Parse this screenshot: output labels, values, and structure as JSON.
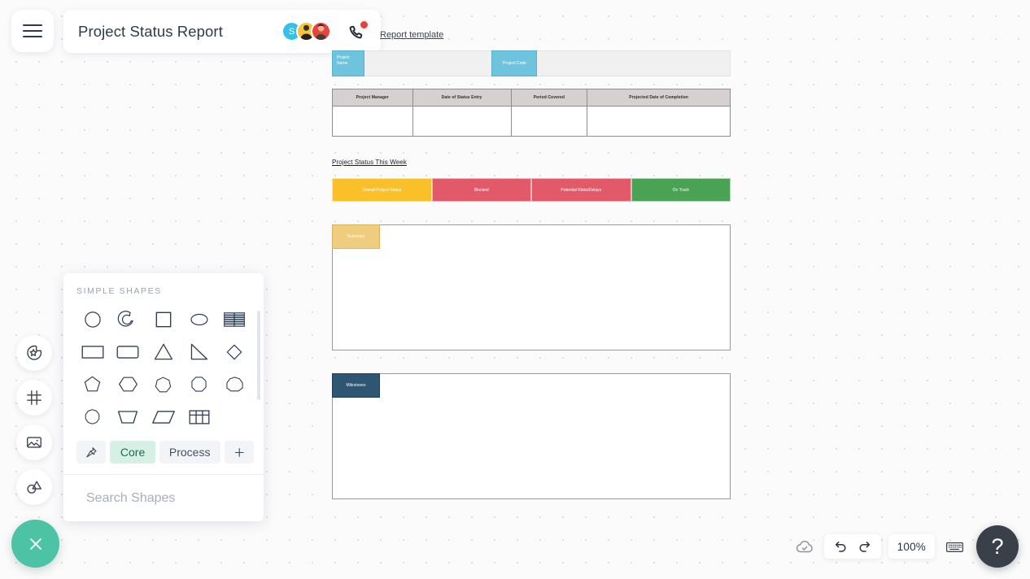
{
  "header": {
    "menu_icon": "hamburger-icon",
    "doc_title": "Project Status Report",
    "avatars": [
      {
        "initial": "S",
        "color": "#37bfe8",
        "type": "initial"
      },
      {
        "initial": "",
        "color": "#f5c43c",
        "type": "photo"
      },
      {
        "initial": "",
        "color": "#e8443f",
        "type": "photo"
      }
    ],
    "phone_icon": "phone-call-icon",
    "phone_badge": true,
    "template_link": "Report template"
  },
  "left_rail": {
    "items": [
      {
        "icon": "sticker-star-icon",
        "label": "Stickers"
      },
      {
        "icon": "frame-icon",
        "label": "Frame"
      },
      {
        "icon": "image-icon",
        "label": "Image"
      },
      {
        "icon": "shapes-icon",
        "label": "Shapes"
      }
    ],
    "close_button": {
      "icon": "close-x-icon",
      "color": "#4cc3a5"
    }
  },
  "document": {
    "project_name_label": "Project Name",
    "project_code_label": "Project Code",
    "info_table": {
      "headers": [
        "Project Manager",
        "Date of Status Entry",
        "Period Covered",
        "Projected Date of Completion"
      ],
      "row": [
        "",
        "",
        "",
        ""
      ]
    },
    "status_heading": "Project Status This Week",
    "status_cells": [
      {
        "label": "Overall Project Status",
        "color": "#f9c02a"
      },
      {
        "label": "Blocked",
        "color": "#e2596a"
      },
      {
        "label": "Potential Risks/Delays",
        "color": "#e2596a"
      },
      {
        "label": "On Track",
        "color": "#4aa354"
      }
    ],
    "blocks": [
      {
        "tag": "Summary",
        "color": "#eecd7f",
        "border": "#d8b461"
      },
      {
        "tag": "Milestones",
        "color": "#2e5571",
        "border": "#1f3f56"
      }
    ]
  },
  "shapes_panel": {
    "heading": "Simple Shapes",
    "shapes": [
      {
        "name": "circle-shape"
      },
      {
        "name": "arc-shape"
      },
      {
        "name": "square-shape"
      },
      {
        "name": "ellipse-shape"
      },
      {
        "name": "striped-table-shape"
      },
      {
        "name": "rectangle-shape"
      },
      {
        "name": "rounded-rectangle-shape"
      },
      {
        "name": "triangle-shape"
      },
      {
        "name": "right-triangle-shape"
      },
      {
        "name": "diamond-shape"
      },
      {
        "name": "pentagon-shape"
      },
      {
        "name": "hexagon-shape"
      },
      {
        "name": "heptagon-shape"
      },
      {
        "name": "octagon-shape"
      },
      {
        "name": "nonagon-shape"
      },
      {
        "name": "decagon-shape"
      },
      {
        "name": "trapezoid-shape"
      },
      {
        "name": "parallelogram-shape"
      },
      {
        "name": "table-shape"
      }
    ],
    "tabs": [
      {
        "label": "",
        "icon": "pin-icon",
        "active": false
      },
      {
        "label": "Core",
        "icon": "",
        "active": true
      },
      {
        "label": "Process",
        "icon": "",
        "active": false
      },
      {
        "label": "+",
        "icon": "plus-icon",
        "active": false
      }
    ],
    "search_placeholder": "Search Shapes",
    "search_value": "",
    "search_icon": "search-icon",
    "more_icon": "kebab-menu-icon"
  },
  "bottom_toolbar": {
    "save_status_icon": "cloud-check-icon",
    "undo_icon": "undo-arrow-icon",
    "redo_icon": "redo-arrow-icon",
    "zoom_level": "100%",
    "keyboard_icon": "keyboard-icon",
    "help_label": "?"
  }
}
